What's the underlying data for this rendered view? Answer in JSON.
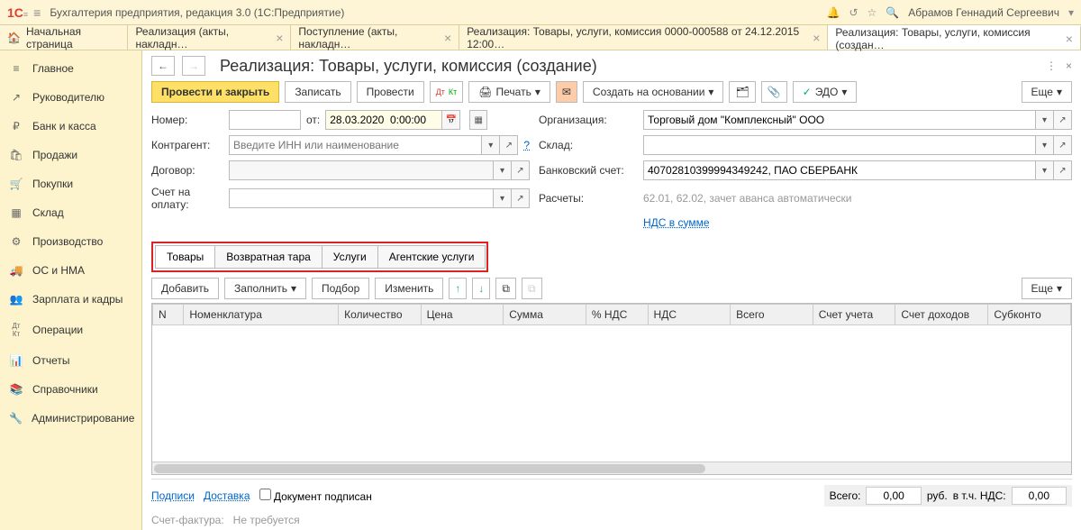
{
  "app": {
    "logo": "1С",
    "title": "Бухгалтерия предприятия, редакция 3.0   (1С:Предприятие)",
    "user": "Абрамов Геннадий Сергеевич"
  },
  "tabs": [
    {
      "label": "Начальная страница",
      "home": true
    },
    {
      "label": "Реализация (акты, накладн…"
    },
    {
      "label": "Поступление (акты, накладн…"
    },
    {
      "label": "Реализация: Товары, услуги, комиссия 0000-000588 от 24.12.2015 12:00…"
    },
    {
      "label": "Реализация: Товары, услуги, комиссия (создан…",
      "active": true
    }
  ],
  "sidebar": [
    {
      "icon": "≡",
      "label": "Главное"
    },
    {
      "icon": "↗",
      "label": "Руководителю"
    },
    {
      "icon": "₽",
      "label": "Банк и касса"
    },
    {
      "icon": "🛍",
      "label": "Продажи"
    },
    {
      "icon": "🛒",
      "label": "Покупки"
    },
    {
      "icon": "▦",
      "label": "Склад"
    },
    {
      "icon": "⚙",
      "label": "Производство"
    },
    {
      "icon": "🚚",
      "label": "ОС и НМА"
    },
    {
      "icon": "👥",
      "label": "Зарплата и кадры"
    },
    {
      "icon": "Дт Кт",
      "label": "Операции"
    },
    {
      "icon": "📊",
      "label": "Отчеты"
    },
    {
      "icon": "📚",
      "label": "Справочники"
    },
    {
      "icon": "🔧",
      "label": "Администрирование"
    }
  ],
  "page": {
    "title": "Реализация: Товары, услуги, комиссия (создание)"
  },
  "toolbar": {
    "post_close": "Провести и закрыть",
    "save": "Записать",
    "post": "Провести",
    "print": "Печать",
    "create_based": "Создать на основании",
    "edo": "ЭДО",
    "more": "Еще"
  },
  "form": {
    "number_label": "Номер:",
    "from_label": "от:",
    "date_value": "28.03.2020  0:00:00",
    "org_label": "Организация:",
    "org_value": "Торговый дом \"Комплексный\" ООО",
    "contragent_label": "Контрагент:",
    "contragent_placeholder": "Введите ИНН или наименование",
    "warehouse_label": "Склад:",
    "contract_label": "Договор:",
    "bank_label": "Банковский счет:",
    "bank_value": "40702810399994349242, ПАО СБЕРБАНК",
    "invoice_label": "Счет на оплату:",
    "calc_label": "Расчеты:",
    "calc_value": "62.01, 62.02, зачет аванса автоматически",
    "vat_link": "НДС в сумме"
  },
  "doc_tabs": [
    "Товары",
    "Возвратная тара",
    "Услуги",
    "Агентские услуги"
  ],
  "tbl_toolbar": {
    "add": "Добавить",
    "fill": "Заполнить",
    "pick": "Подбор",
    "edit": "Изменить",
    "more": "Еще"
  },
  "columns": [
    "N",
    "Номенклатура",
    "Количество",
    "Цена",
    "Сумма",
    "% НДС",
    "НДС",
    "Всего",
    "Счет учета",
    "Счет доходов",
    "Субконто"
  ],
  "footer": {
    "sign_link": "Подписи",
    "delivery_link": "Доставка",
    "signed_cb": "Документ подписан",
    "total_label": "Всего:",
    "total_value": "0,00",
    "currency": "руб.",
    "vat_label": "в т.ч. НДС:",
    "vat_value": "0,00",
    "invoice_doc_label": "Счет-фактура:",
    "invoice_doc_value": "Не требуется"
  }
}
